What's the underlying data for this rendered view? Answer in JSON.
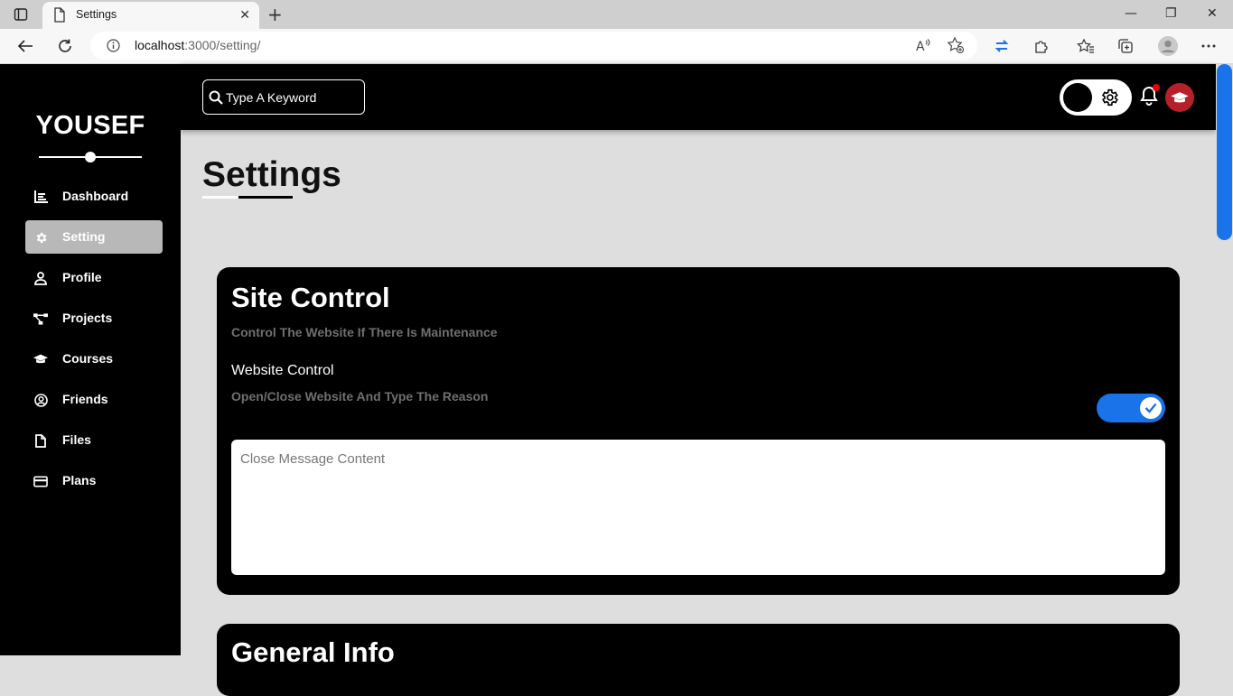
{
  "browser": {
    "tab_title": "Settings",
    "url_host": "localhost",
    "url_rest": ":3000/setting/"
  },
  "app": {
    "brand": "YOUSEF",
    "search_placeholder": "Type A Keyword",
    "accent_color": "#1a73e8",
    "avatar_color": "#b5202b"
  },
  "sidebar": {
    "items": [
      {
        "label": "Dashboard",
        "icon": "chart-icon",
        "active": false
      },
      {
        "label": "Setting",
        "icon": "gear-icon",
        "active": true
      },
      {
        "label": "Profile",
        "icon": "user-icon",
        "active": false
      },
      {
        "label": "Projects",
        "icon": "diagram-icon",
        "active": false
      },
      {
        "label": "Courses",
        "icon": "graduation-cap-icon",
        "active": false
      },
      {
        "label": "Friends",
        "icon": "user-circle-icon",
        "active": false
      },
      {
        "label": "Files",
        "icon": "file-icon",
        "active": false
      },
      {
        "label": "Plans",
        "icon": "credit-card-icon",
        "active": false
      }
    ]
  },
  "page": {
    "title": "Settings"
  },
  "site_control": {
    "title": "Site Control",
    "subtitle": "Control The Website If There Is Maintenance",
    "control_title": "Website Control",
    "control_desc": "Open/Close Website And Type The Reason",
    "enabled": true,
    "message_placeholder": "Close Message Content"
  },
  "general_info": {
    "title": "General Info"
  }
}
